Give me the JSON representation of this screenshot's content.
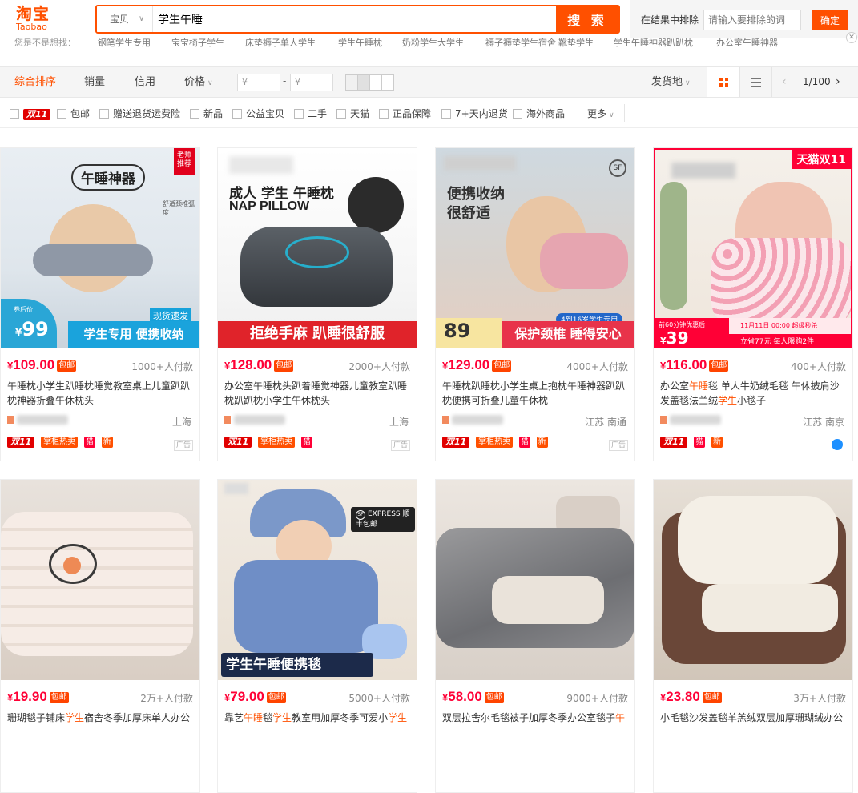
{
  "header": {
    "logo_cn": "淘宝",
    "logo_en": "Taobao",
    "scope": "宝贝",
    "query": "学生午睡",
    "search_label": "搜 索",
    "exclude_label": "在结果中排除",
    "exclude_placeholder": "请输入要排除的词",
    "exclude_btn": "确定"
  },
  "suggestions": {
    "hint": "您是不是想找：",
    "items": [
      "钢笔学生专用",
      "宝宝椅子学生",
      "床垫褥子单人学生",
      "学生午睡枕",
      "奶粉学生大学生",
      "褥子褥垫学生宿舍",
      "靴垫学生",
      "学生午睡神器趴趴枕",
      "办公室午睡神器"
    ]
  },
  "sort": {
    "items": [
      "综合排序",
      "销量",
      "信用",
      "价格"
    ],
    "price_low": "¥",
    "price_high": "¥",
    "ship_from": "发货地",
    "page": "1/100"
  },
  "filters": [
    "双11",
    "包邮",
    "赠送退货运费险",
    "新品",
    "公益宝贝",
    "二手",
    "天猫",
    "正品保障",
    "7+天内退货",
    "海外商品",
    "更多"
  ],
  "products": [
    {
      "price": "109.00",
      "buyers": "1000+人付款",
      "title": "午睡枕小学生趴睡枕睡觉教室桌上儿童趴趴枕神器折叠午休枕头",
      "loc": "上海",
      "tags": [
        "双11",
        "掌柜热卖",
        "天猫",
        "新"
      ],
      "ad": "广告",
      "img_title": "午睡神器",
      "img_badge": "老师推荐",
      "img_band": "学生专用 便携收纳",
      "img_price": "99",
      "img_tag": "现货速发",
      "img_sub": "舒适颈椎弧度",
      "img_pre": "券后价"
    },
    {
      "price": "128.00",
      "buyers": "2000+人付款",
      "title": "办公室午睡枕头趴着睡觉神器儿童教室趴睡枕趴趴枕小学生午休枕头",
      "loc": "上海",
      "tags": [
        "双11",
        "掌柜热卖",
        "天猫"
      ],
      "ad": "广告",
      "img_title": "成人 学生 午睡枕",
      "img_sub": "NAP PILLOW",
      "img_band": "拒绝手麻 趴睡很舒服"
    },
    {
      "price": "129.00",
      "buyers": "4000+人付款",
      "title": "午睡枕趴睡枕小学生桌上抱枕午睡神器趴趴枕便携可折叠儿童午休枕",
      "loc": "江苏 南通",
      "tags": [
        "双11",
        "掌柜热卖",
        "天猫",
        "新"
      ],
      "ad": "广告",
      "img_title": "便携收纳 很舒适",
      "img_band": "保护颈椎 睡得安心",
      "img_price": "89",
      "img_tag": "4到16岁学生专用"
    },
    {
      "price": "116.00",
      "buyers": "400+人付款",
      "title": "办公室午睡毯 单人牛奶绒毛毯 午休披肩沙发盖毯法兰绒学生小毯子",
      "loc": "江苏 南京",
      "tags": [
        "双11",
        "天猫",
        "新"
      ],
      "img_badge": "天猫双11",
      "img_price": "39",
      "img_pre": "前60分钟优惠后",
      "img_note": "11月11日 00:00 超级秒杀",
      "img_note2": "立省77元 每人限购2件"
    },
    {
      "price": "19.90",
      "buyers": "2万+人付款",
      "title": "珊瑚毯子铺床学生宿舍冬季加厚床单人办公"
    },
    {
      "price": "79.00",
      "buyers": "5000+人付款",
      "title": "靠艺午睡毯学生教室用加厚冬季可爱小学生",
      "img_band": "学生午睡便携毯",
      "img_badge": "EXPRESS 顺丰包邮"
    },
    {
      "price": "58.00",
      "buyers": "9000+人付款",
      "title": "双层拉舍尔毛毯被子加厚冬季办公室毯子午"
    },
    {
      "price": "23.80",
      "buyers": "3万+人付款",
      "title": "小毛毯沙发盖毯羊羔绒双层加厚珊瑚绒办公"
    }
  ],
  "colors": {
    "accent": "#ff5000",
    "price": "#ff0036"
  }
}
